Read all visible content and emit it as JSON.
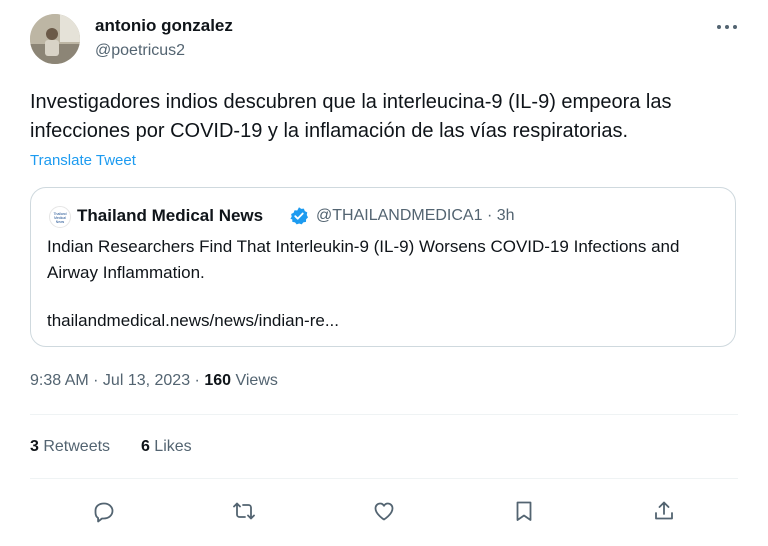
{
  "tweet": {
    "author_name": "antonio gonzalez",
    "author_handle": "@poetricus2",
    "text": "Investigadores indios descubren que la interleucina-9 (IL-9) empeora las infecciones por COVID-19 y la inflamación de las vías respiratorias.",
    "translate_label": "Translate Tweet",
    "quoted": {
      "name": "Thailand Medical News",
      "handle_time": "@THAILANDMEDICA1 · 3h",
      "logo_text": "Thailand Medical News",
      "text": "Indian Researchers Find That Interleukin-9 (IL-9) Worsens COVID-19 Infections and Airway Inflammation.",
      "link": "thailandmedical.news/news/indian-re..."
    },
    "time": "9:38 AM · Jul 13, 2023 · ",
    "views_count": "160",
    "views_label": " Views",
    "retweets_count": "3",
    "retweets_label": " Retweets",
    "likes_count": "6",
    "likes_label": " Likes"
  },
  "colors": {
    "text": "#0f1419",
    "secondary": "#536471",
    "link": "#1d9bf0",
    "border": "#cfd9de",
    "divider": "#eff3f4",
    "verified": "#1d9bf0"
  },
  "icons": {
    "more": "more-horizontal-icon",
    "verified": "verified-badge-icon",
    "reply": "reply-icon",
    "retweet": "retweet-icon",
    "like": "heart-icon",
    "bookmark": "bookmark-icon",
    "share": "share-icon"
  }
}
